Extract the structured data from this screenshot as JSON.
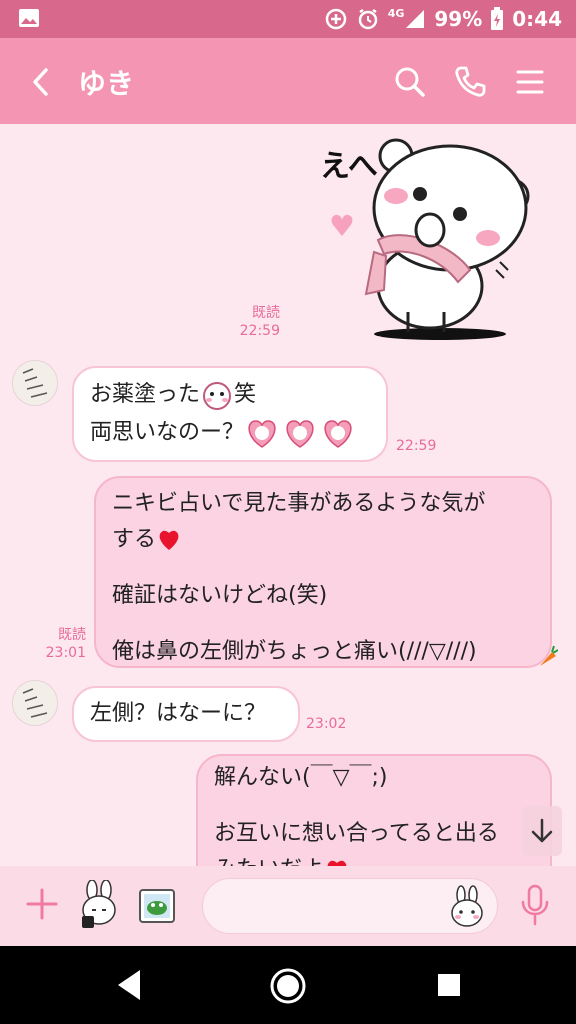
{
  "status": {
    "battery": "99%",
    "network": "4G",
    "time": "0:44"
  },
  "header": {
    "title": "ゆき",
    "icons": [
      "back-icon",
      "search-icon",
      "phone-icon",
      "menu-icon"
    ]
  },
  "messages": [
    {
      "type": "sticker",
      "side": "out",
      "sticker_text": "えへ",
      "read": "既読",
      "time": "22:59"
    },
    {
      "type": "text",
      "side": "in",
      "lines": [
        "お薬塗った",
        "笑",
        "両思いなのー？"
      ],
      "time": "22:59"
    },
    {
      "type": "text",
      "side": "out",
      "lines": [
        "ニキビ占いで見た事があるような気が",
        "する",
        "確証はないけどね(笑)",
        "俺は鼻の左側がちょっと痛い(///▽///)"
      ],
      "read": "既読",
      "time": "23:01"
    },
    {
      "type": "text",
      "side": "in",
      "lines": [
        "左側？はなーに？"
      ],
      "time": "23:02"
    },
    {
      "type": "text",
      "side": "out",
      "lines": [
        "解んない(￣▽￣;)",
        "お互いに想い合ってると出る",
        "みたいだよ"
      ]
    }
  ],
  "colors": {
    "status_bar": "#d9698c",
    "header": "#f395b3",
    "background": "#fde8ef",
    "accent": "#e86b9a"
  }
}
